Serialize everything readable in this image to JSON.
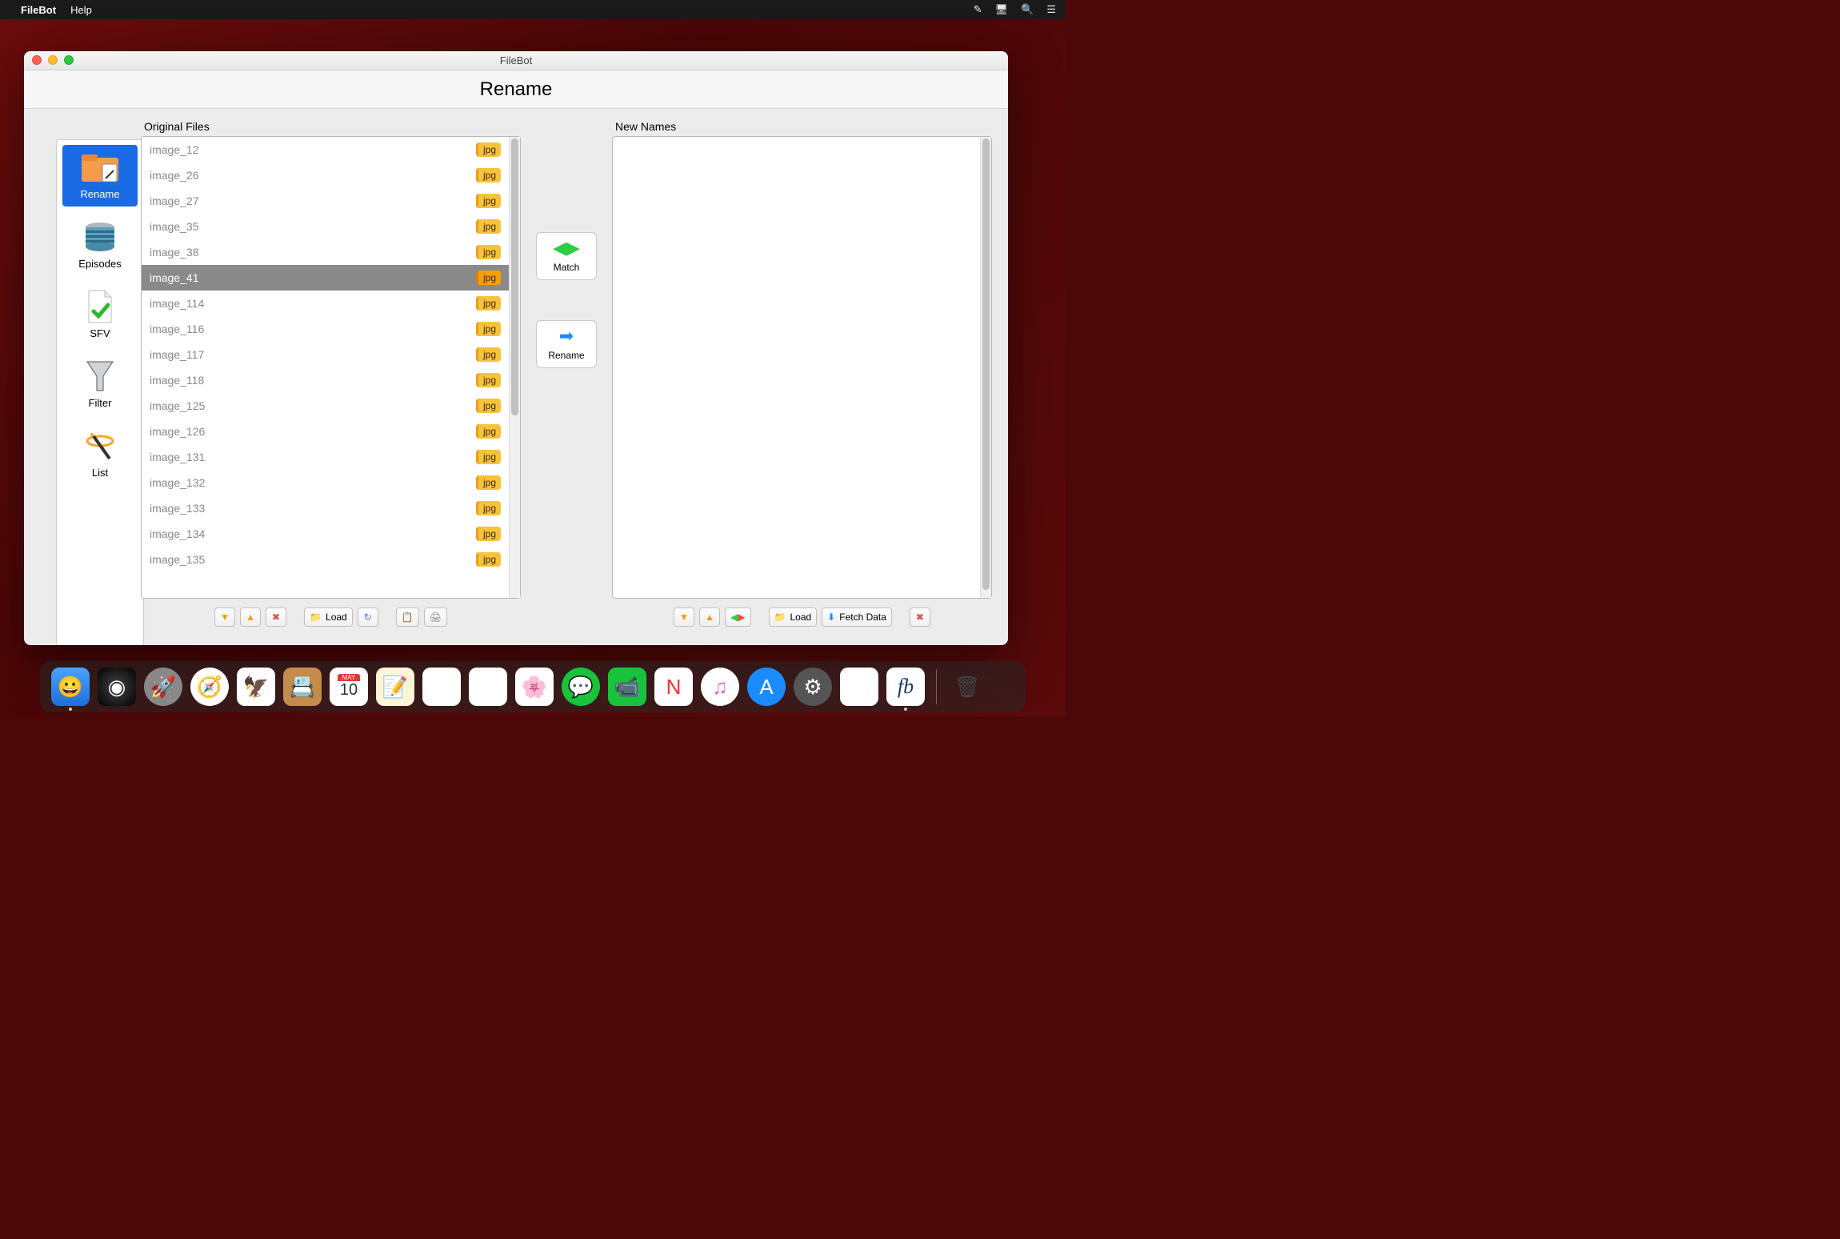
{
  "menubar": {
    "app": "FileBot",
    "items": [
      "Help"
    ]
  },
  "window": {
    "title": "FileBot",
    "page_heading": "Rename"
  },
  "sidebar": {
    "items": [
      {
        "label": "Rename"
      },
      {
        "label": "Episodes"
      },
      {
        "label": "SFV"
      },
      {
        "label": "Filter"
      },
      {
        "label": "List"
      }
    ]
  },
  "panels": {
    "original": {
      "title": "Original Files",
      "files": [
        {
          "name": "image_12",
          "ext": "jpg"
        },
        {
          "name": "image_26",
          "ext": "jpg"
        },
        {
          "name": "image_27",
          "ext": "jpg"
        },
        {
          "name": "image_35",
          "ext": "jpg"
        },
        {
          "name": "image_38",
          "ext": "jpg"
        },
        {
          "name": "image_41",
          "ext": "jpg",
          "selected": true
        },
        {
          "name": "image_114",
          "ext": "jpg"
        },
        {
          "name": "image_116",
          "ext": "jpg"
        },
        {
          "name": "image_117",
          "ext": "jpg"
        },
        {
          "name": "image_118",
          "ext": "jpg"
        },
        {
          "name": "image_125",
          "ext": "jpg"
        },
        {
          "name": "image_126",
          "ext": "jpg"
        },
        {
          "name": "image_131",
          "ext": "jpg"
        },
        {
          "name": "image_132",
          "ext": "jpg"
        },
        {
          "name": "image_133",
          "ext": "jpg"
        },
        {
          "name": "image_134",
          "ext": "jpg"
        },
        {
          "name": "image_135",
          "ext": "jpg"
        }
      ],
      "toolbar": {
        "load": "Load"
      }
    },
    "new": {
      "title": "New Names",
      "toolbar": {
        "load": "Load",
        "fetch": "Fetch Data"
      }
    }
  },
  "middle": {
    "match": "Match",
    "rename": "Rename"
  },
  "dock": {
    "calendar": {
      "month": "MAY",
      "day": "10"
    }
  }
}
